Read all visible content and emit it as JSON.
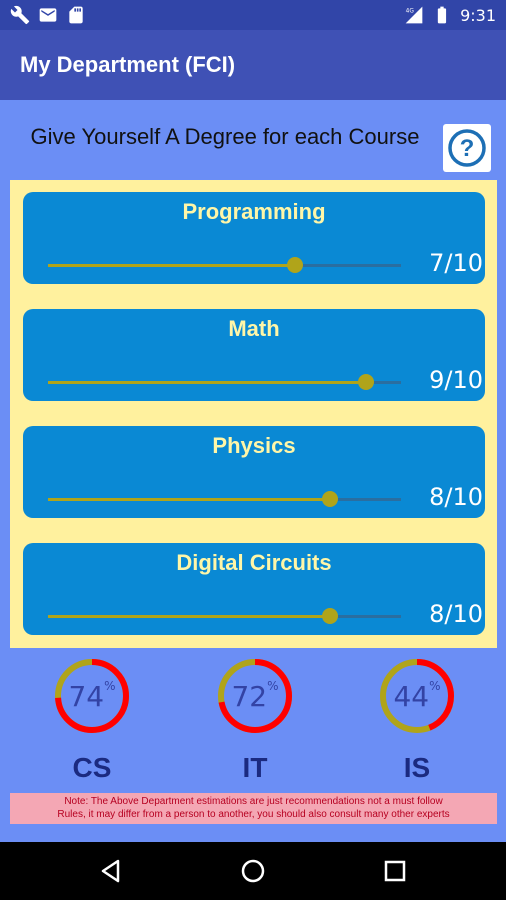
{
  "status_bar": {
    "time": "9:31",
    "left_icons": [
      "wrench-icon",
      "email-icon",
      "sd-card-icon"
    ],
    "right_icons": [
      "signal-4g-icon",
      "battery-icon"
    ]
  },
  "app_bar": {
    "title": "My Department (FCI)"
  },
  "instructions": {
    "text": "Give Yourself A Degree for each Course"
  },
  "help_button": {
    "icon": "help-icon"
  },
  "courses": [
    {
      "name": "Programming",
      "score": "7/10",
      "value": 7,
      "max": 10
    },
    {
      "name": "Math",
      "score": "9/10",
      "value": 9,
      "max": 10
    },
    {
      "name": "Physics",
      "score": "8/10",
      "value": 8,
      "max": 10
    },
    {
      "name": "Digital Circuits",
      "score": "8/10",
      "value": 8,
      "max": 10
    }
  ],
  "departments": [
    {
      "name": "CS",
      "percent": "74",
      "pct_symbol": "%",
      "value": 74
    },
    {
      "name": "IT",
      "percent": "72",
      "pct_symbol": "%",
      "value": 72
    },
    {
      "name": "IS",
      "percent": "44",
      "pct_symbol": "%",
      "value": 44
    }
  ],
  "note": {
    "line1": "Note: The Above Department estimations are just  recommendations not a must follow",
    "line2": "Rules, it may differ from a person to another, you should also consult many other experts"
  },
  "colors": {
    "ring_progress": "#ff0000",
    "ring_track": "#b0a41a",
    "card_bg": "#0a89d4",
    "panel_bg": "#fff19e",
    "app_bar": "#3f51b5"
  },
  "nav": {
    "back": "back-icon",
    "home": "home-icon",
    "recents": "recents-icon"
  }
}
